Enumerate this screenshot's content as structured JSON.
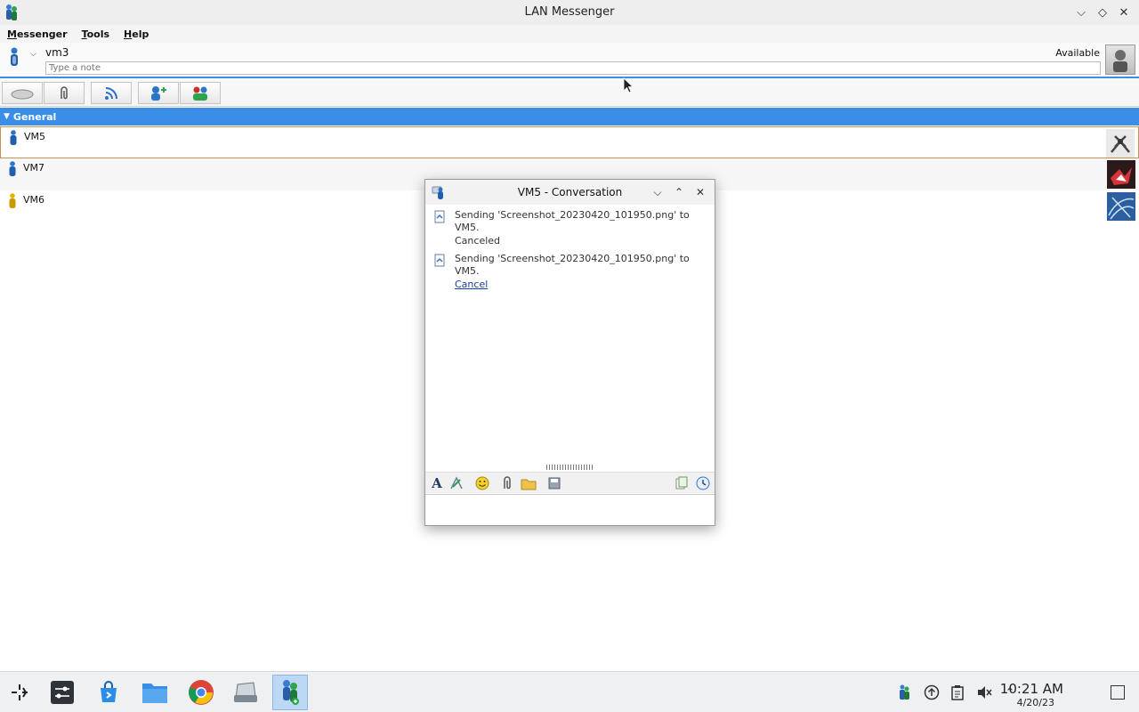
{
  "window": {
    "title": "LAN Messenger"
  },
  "menu": [
    "Messenger",
    "Tools",
    "Help"
  ],
  "user": {
    "name": "vm3",
    "status": "Available",
    "note_placeholder": "Type a note"
  },
  "group": {
    "name": "General"
  },
  "contacts": [
    {
      "name": "VM5",
      "status_color": "#2a74c9"
    },
    {
      "name": "VM7",
      "status_color": "#2a74c9"
    },
    {
      "name": "VM6",
      "status_color": "#e0b400"
    }
  ],
  "conversation": {
    "title": "VM5 - Conversation",
    "messages": [
      {
        "text": "Sending 'Screenshot_20230420_101950.png' to VM5.",
        "status": "Canceled"
      },
      {
        "text": "Sending 'Screenshot_20230420_101950.png' to VM5.",
        "link": "Cancel"
      }
    ]
  },
  "clock": {
    "time": "10:21 AM",
    "date": "4/20/23"
  },
  "colors": {
    "accent": "#3a8ee6",
    "selected_border": "#c79153",
    "link": "#1a3ea8"
  }
}
